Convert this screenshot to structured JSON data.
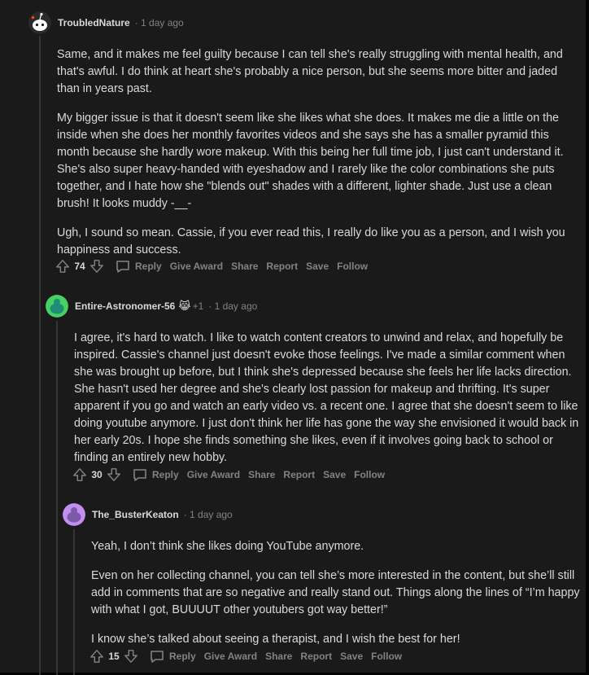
{
  "comments": [
    {
      "author": "TroubledNature",
      "time": "· 1 day ago",
      "paragraphs": [
        "Same, and it makes me feel guilty because I can tell she's really struggling with mental health, and that's awful. I do think at heart she's probably a nice person, but she seems more bitter and jaded than in years past.",
        "My bigger issue is that it doesn't seem like she likes what she does. It makes me die a little on the inside when she does her monthly favorites videos and she says she has a smaller pyramid this month because she hardly wore makeup. With this being her full time job, I just can't understand it. She's also super heavy-handed with eyeshadow and I rarely like the color combinations she puts together, and I hate how she \"blends out\" shades with a different, lighter shade. Just use a clean brush! It looks muddy -__-",
        "Ugh, I sound so mean. Cassie, if you ever read this, I really do like you as a person, and I wish you happiness and success."
      ],
      "score": "74",
      "avatar_color": "#1a1a1b"
    },
    {
      "author": "Entire-Astronomer-56",
      "award_icon": "😹",
      "award_count": "+1",
      "time": "· 1 day ago",
      "paragraphs": [
        "I agree, it's hard to watch. I like to watch content creators to unwind and relax, and hopefully be inspired. Cassie's channel just doesn't evoke those feelings. I've made a similar comment when she was brought up before, but I think she's depressed because she feels her life lacks direction. She hasn't used her degree and she's clearly lost passion for makeup and thrifting. It's super apparent if you go and watch an early video vs. a recent one. I agree that she doesn't seem to like doing youtube anymore. I just don't think her life has gone the way she envisioned it would back in her early 20s. I hope she finds something she likes, even if it involves going back to school or finding an entirely new hobby."
      ],
      "score": "30",
      "avatar_color": "#46d160"
    },
    {
      "author": "The_BusterKeaton",
      "time": "· 1 day ago",
      "paragraphs": [
        "Yeah, I don’t think she likes doing YouTube anymore.",
        "Even on her collecting channel, you can tell she’s more interested in the content, but she’ll still add in comments that are so negative and really stand out. Things along the lines of “I’m happy with what I got, BUUUUT other youtubers got way better!”",
        "I know she’s talked about seeing a therapist, and I wish the best for her!"
      ],
      "score": "15",
      "avatar_color": "#c18ef1"
    }
  ],
  "actions": {
    "reply": "Reply",
    "give_award": "Give Award",
    "share": "Share",
    "report": "Report",
    "save": "Save",
    "follow": "Follow"
  }
}
